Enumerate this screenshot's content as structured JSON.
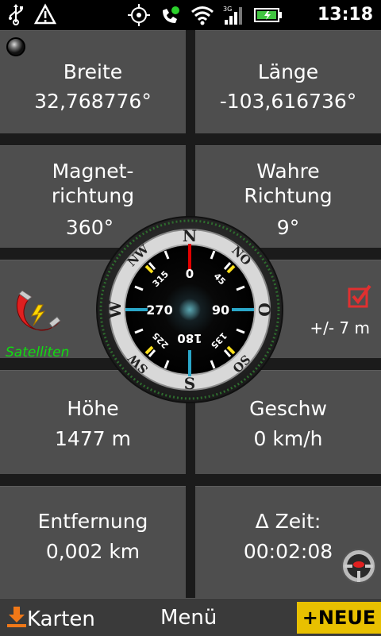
{
  "status_bar": {
    "time": "13:18",
    "icons": [
      "usb-icon",
      "warning-icon",
      "gps-icon",
      "satellite-phone-icon",
      "wifi-icon",
      "signal-icon",
      "battery-icon"
    ]
  },
  "tiles": {
    "latitude": {
      "label": "Breite",
      "value": "32,768776°"
    },
    "longitude": {
      "label": "Länge",
      "value": "-103,616736°"
    },
    "magnetic_direction": {
      "label_line1": "Magnet-",
      "label_line2": "richtung",
      "value": "360°"
    },
    "true_direction": {
      "label_line1": "Wahre",
      "label_line2": "Richtung",
      "value": "9°"
    },
    "accuracy": {
      "value": "+/- 7 m"
    },
    "altitude": {
      "label": "Höhe",
      "value": "1477 m"
    },
    "speed": {
      "label": "Geschw",
      "value": "0 km/h"
    },
    "distance": {
      "label": "Entfernung",
      "value": "0,002 km"
    },
    "delta_time": {
      "label": "Δ Zeit:",
      "value": "00:02:08"
    }
  },
  "satellite_label": "Satelliten",
  "compass": {
    "cardinals": {
      "n": "N",
      "o": "O",
      "s": "S",
      "w": "W"
    },
    "intercardinals": {
      "nw": "NW",
      "no": "NO",
      "sw": "SW",
      "so": "SO"
    },
    "degrees": {
      "d0": "0",
      "d45": "45",
      "d90": "90",
      "d135": "135",
      "d180": "180",
      "d225": "225",
      "d270": "270",
      "d315": "315"
    }
  },
  "bottom_bar": {
    "maps_label": "Karten",
    "menu_label": "Menü",
    "new_label": "+NEUE"
  },
  "colors": {
    "tile_bg": "#4e4e4e",
    "satellite_green": "#10dd10",
    "new_button": "#e8c000",
    "north_needle": "#e00000"
  }
}
